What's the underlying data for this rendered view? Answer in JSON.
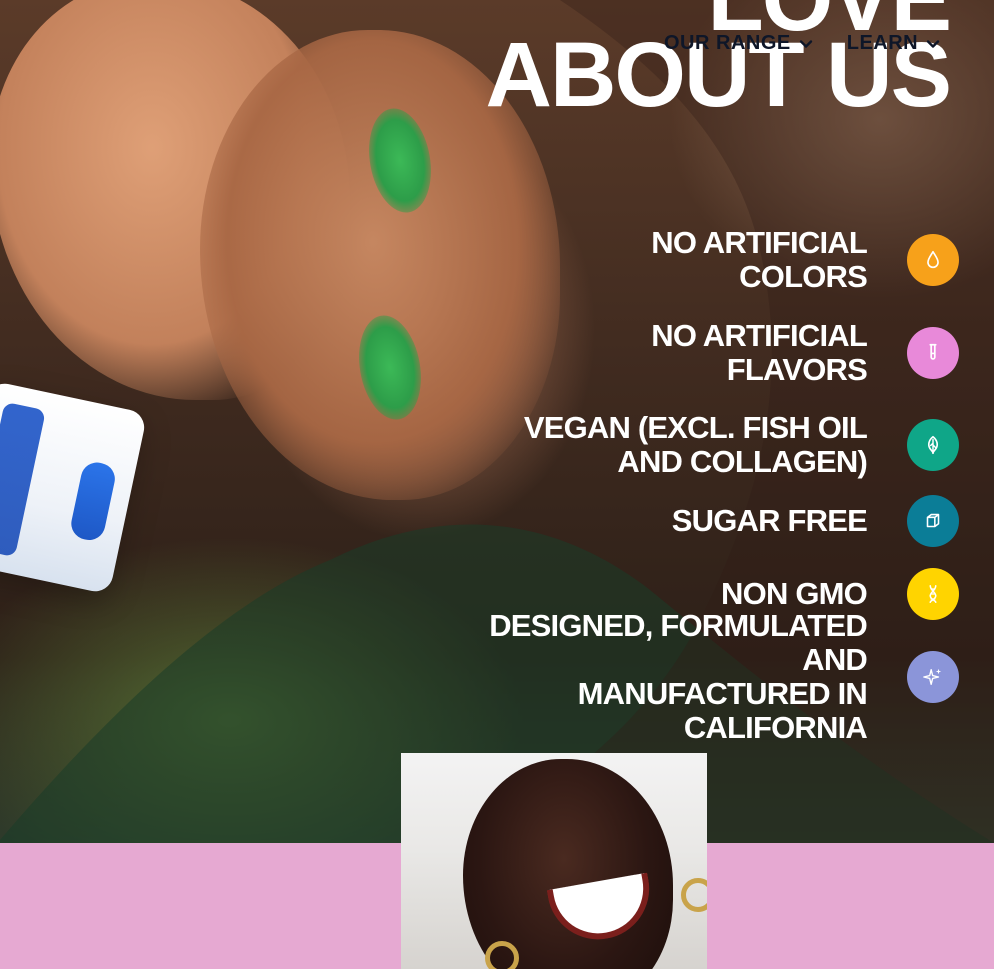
{
  "nav": {
    "items": [
      {
        "label": "OUR RANGE",
        "icon": "chevron-down-icon"
      },
      {
        "label": "LEARN",
        "icon": "chevron-down-icon"
      }
    ]
  },
  "hero": {
    "headline_line1": "LOVE",
    "headline_line2": "ABOUT US"
  },
  "features": [
    {
      "text": "NO ARTIFICIAL\nCOLORS",
      "icon": "drop-icon",
      "color": "#f7a11a"
    },
    {
      "text": "NO ARTIFICIAL\nFLAVORS",
      "icon": "test-tube-icon",
      "color": "#e889d9"
    },
    {
      "text": "VEGAN (EXCL. FISH OIL\nAND COLLAGEN)",
      "icon": "leaf-icon",
      "color": "#0fa688"
    },
    {
      "text": "SUGAR FREE",
      "icon": "cube-icon",
      "color": "#0b7d97"
    },
    {
      "text": "NON GMO",
      "icon": "dna-icon",
      "color": "#ffd400"
    },
    {
      "text": "DESIGNED, FORMULATED AND\nMANUFACTURED IN CALIFORNIA",
      "icon": "sparkle-icon",
      "color": "#8b95d9"
    }
  ],
  "colors": {
    "pink_band": "#e6a9d2"
  }
}
